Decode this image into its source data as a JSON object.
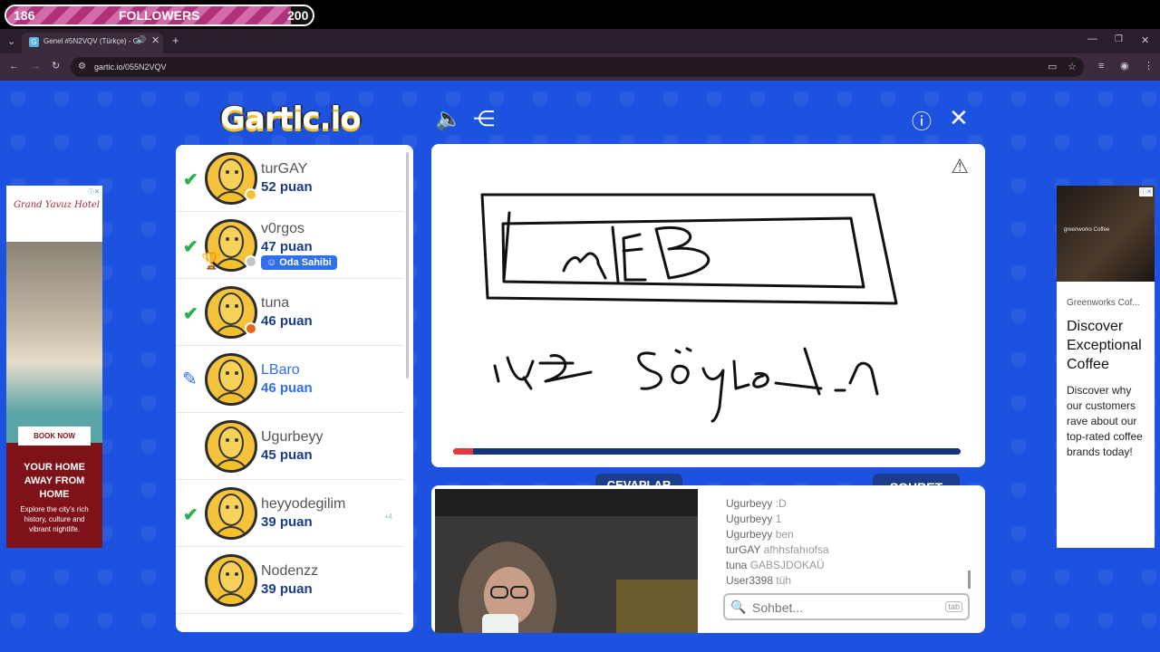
{
  "overlay": {
    "followers_current": "186",
    "followers_label": "FOLLOWERS",
    "followers_goal": "200",
    "progress_fraction": 0.93
  },
  "browser": {
    "tab_title": "Genel #5N2VQV (Türkçe) - G",
    "favicon": "G",
    "url": "gartic.io/055N2VQV",
    "icons": [
      "tab-menu-icon",
      "speaker-icon",
      "close-icon",
      "new-tab-icon",
      "minimize-icon",
      "maximize-icon",
      "window-close-icon",
      "back-icon",
      "forward-icon",
      "reload-icon",
      "site-info-icon",
      "cast-icon",
      "bookmark-star-icon",
      "extensions-icon",
      "profile-icon",
      "menu-icon"
    ]
  },
  "game": {
    "logo": "Gartic.io",
    "players": [
      {
        "name": "turGAY",
        "points": "52 puan",
        "guessed": true,
        "status": "#f2c230"
      },
      {
        "name": "v0rgos",
        "points": "47 puan",
        "guessed": true,
        "status": "#c4c4c4",
        "badge": "Oda Sahibi"
      },
      {
        "name": "tuna",
        "points": "46 puan",
        "guessed": true,
        "status": "#e06a1a"
      },
      {
        "name": "LBaro",
        "points": "46 puan",
        "drawing": true
      },
      {
        "name": "Ugurbeyy",
        "points": "45 puan"
      },
      {
        "name": "heyyodegilim",
        "points": "39 puan",
        "guessed": true
      },
      {
        "name": "Nodenzz",
        "points": "39 puan"
      }
    ],
    "extra_mark": "+4",
    "timer_fraction": 0.04,
    "answers_tab": "CEVAPLAR",
    "chat_tab": "SOHBET",
    "chat": [
      {
        "user": "Ugurbeyy",
        "text": ":D"
      },
      {
        "user": "Ugurbeyy",
        "text": "1"
      },
      {
        "user": "Ugurbeyy",
        "text": "ben"
      },
      {
        "user": "turGAY",
        "text": "afhhsfahıofsa"
      },
      {
        "user": "tuna",
        "text": "GABSJDOKAÜ"
      },
      {
        "user": "User3398",
        "text": "tüh"
      }
    ],
    "chat_placeholder": "Sohbet...",
    "chat_key_hint": "tab"
  },
  "ads": {
    "left": {
      "logo": "Grand Yavuz Hotel",
      "button": "BOOK NOW",
      "headline": "YOUR HOME AWAY FROM HOME",
      "sub": "Explore the city's rich history, culture and vibrant nightlife."
    },
    "right": {
      "brand_image": "greenworks Coffee",
      "advertiser": "Greenworks Cof...",
      "headline": "Discover Exceptional Coffee",
      "body": "Discover why our customers rave about our top-rated coffee brands today!"
    }
  }
}
